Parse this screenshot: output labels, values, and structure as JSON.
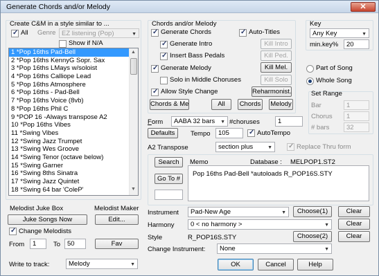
{
  "window": {
    "title": "Generate Chords and/or Melody",
    "close": "✕"
  },
  "style_box": {
    "title": "Create C&M in a style similar to ...",
    "all_label": "All",
    "genre_label": "Genre",
    "genre_value": "EZ listening (Pop)",
    "show_na_label": "Show if N/A",
    "all_checked": true,
    "show_na_checked": false
  },
  "styles": [
    "1 *Pop 16ths Pad-Bell",
    "2 *Pop 16ths KennyG Sopr. Sax",
    "3 *Pop 16ths LMays w/soloist",
    "4 *Pop 16ths Calliope Lead",
    "5 *Pop 16ths Atmosphere",
    "6 *Pop 16ths - Pad-Bell",
    "7 *Pop 16ths Voice (8vb)",
    "8 *Pop 16ths Phil C",
    "9 *POP 16 -Always transpose A2",
    "10 *Pop 16ths Vibes",
    "11 *Swing Vibes",
    "12 *Swing Jazz Trumpet",
    "13 *Swing Wes Groove",
    "14 *Swing Tenor (octave below)",
    "15 *Swing Garner",
    "16 *Swing 8ths Sinatra",
    "17 *Swing Jazz Quintet",
    "18 *Swing 64 bar 'ColeP'"
  ],
  "melodist_juke": {
    "title": "Melodist Juke Box",
    "juke_button": "Juke Songs Now",
    "change_label": "Change Melodists",
    "change_checked": true,
    "from_label": "From",
    "from_value": "1",
    "to_label": "To",
    "to_value": "50"
  },
  "melodist_maker": {
    "title": "Melodist Maker",
    "edit_button": "Edit...",
    "fav_button": "Fav"
  },
  "write_track": {
    "label": "Write to track:",
    "value": "Melody"
  },
  "chords_melody": {
    "title": "Chords and/or Melody",
    "generate_chords": "Generate Chords",
    "auto_titles": "Auto-Titles",
    "generate_intro": "Generate Intro",
    "kill_intro": "Kill Intro",
    "insert_bass": "Insert Bass Pedals",
    "kill_ped": "Kill Ped.",
    "generate_melody": "Generate Melody",
    "kill_mel": "Kill Mel.",
    "solo_middle": "Solo in Middle Choruses",
    "kill_solo": "Kill Solo",
    "allow_style": "Allow Style Change",
    "reharmonist": "Reharmonist...",
    "btn_cm": "Chords & Mel.",
    "btn_all": "All",
    "btn_chords": "Chords",
    "btn_melody": "Melody"
  },
  "form_row": {
    "form_label": "Form",
    "form_value": "AABA 32 bars",
    "choruses_label": "#choruses",
    "choruses_value": "1",
    "defaults": "Defaults",
    "tempo_label": "Tempo",
    "tempo_value": "105",
    "auto_tempo": "AutoTempo",
    "transpose_label": "A2 Transpose",
    "transpose_value": "section plus",
    "replace_label": "Replace Thru form"
  },
  "key": {
    "title": "Key",
    "value": "Any Key",
    "min_key_label": "min.key%",
    "min_key_value": "20"
  },
  "song": {
    "part": "Part of Song",
    "whole": "Whole Song"
  },
  "set_range": {
    "title": "Set Range",
    "bar_label": "Bar",
    "bar_value": "1",
    "chorus_label": "Chorus",
    "chorus_value": "1",
    "bars_label": "# bars",
    "bars_value": "32"
  },
  "memo": {
    "search": "Search",
    "memo_label": "Memo",
    "database_label": "Database :",
    "database_value": "MELPOP1.ST2",
    "goto": "Go To #",
    "text": "Pop 16ths Pad-Bell   *autoloads R_POP16S.STY"
  },
  "instruments": {
    "instrument_label": "Instrument",
    "instrument_value": "Pad-New Age",
    "choose1": "Choose(1)",
    "clear1": "Clear",
    "harmony_label": "Harmony",
    "harmony_value": "0 < no harmony >",
    "clear2": "Clear",
    "style_label": "Style",
    "style_value": "R_POP16S.STY",
    "choose2": "Choose(2)",
    "clear3": "Clear",
    "change_label": "Change Instrument:",
    "change_value": "None"
  },
  "footer": {
    "ok": "OK",
    "cancel": "Cancel",
    "help": "Help"
  }
}
